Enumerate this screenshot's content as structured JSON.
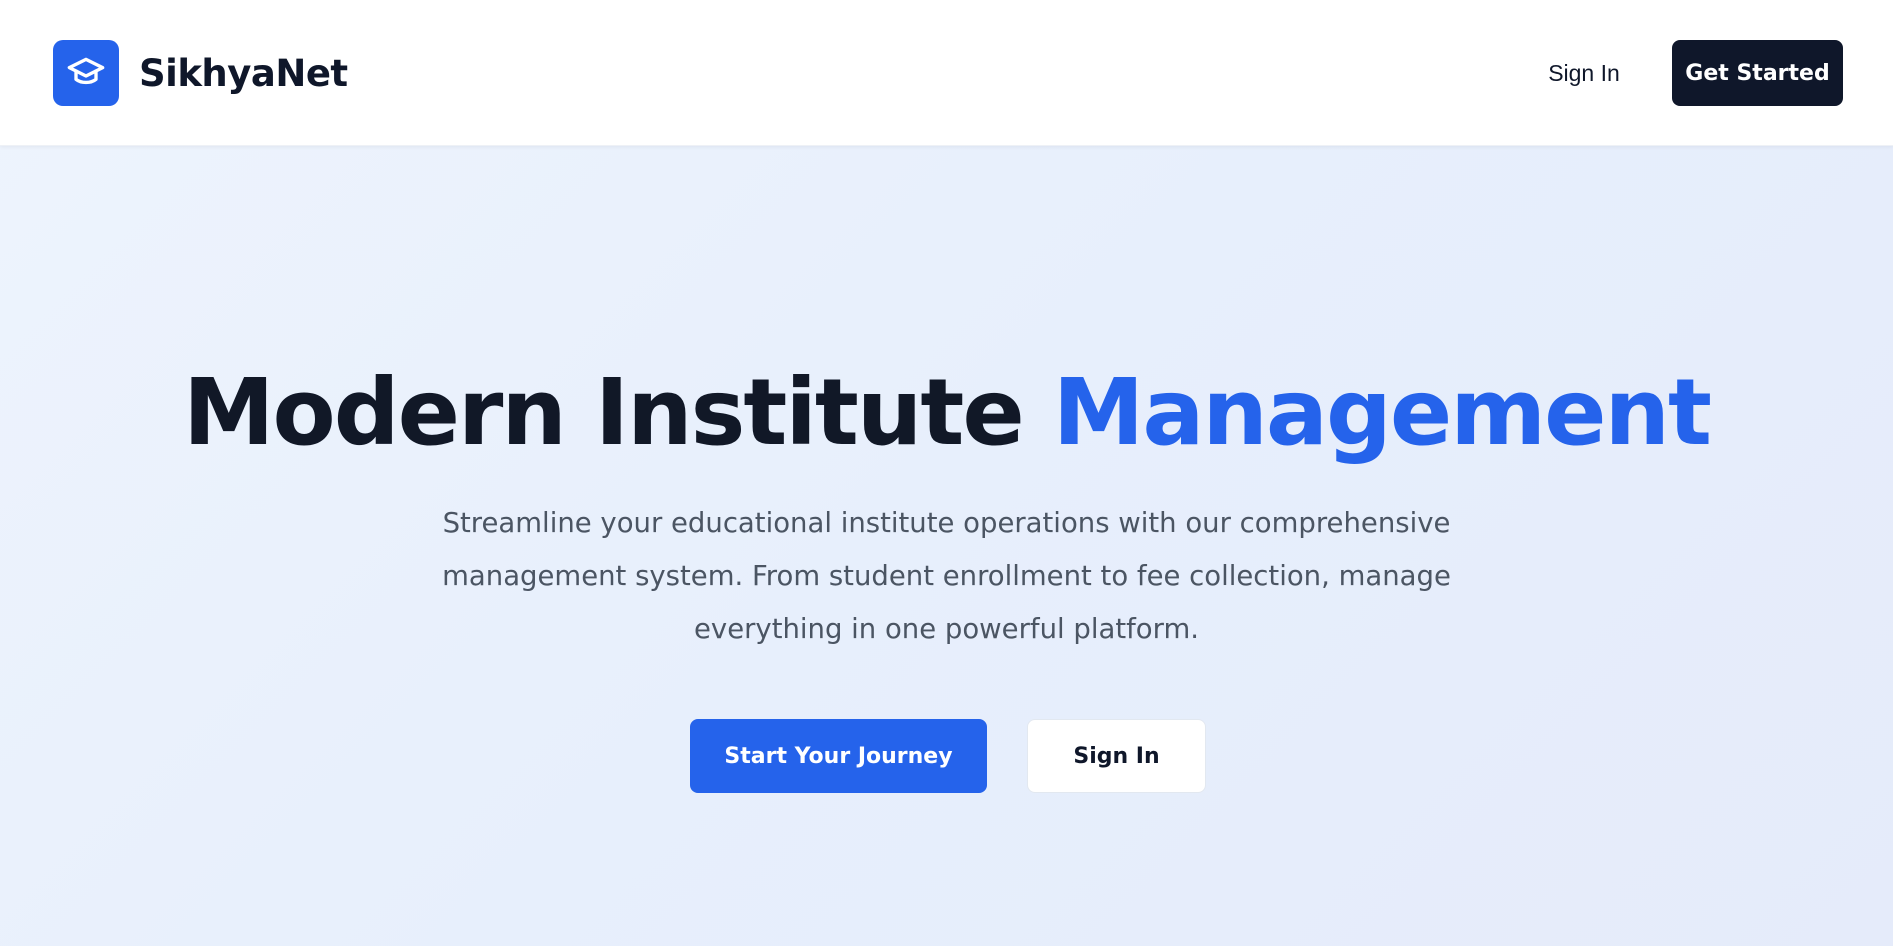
{
  "header": {
    "brand": "SikhyaNet",
    "logo_icon": "graduation-cap-icon",
    "sign_in_label": "Sign In",
    "get_started_label": "Get Started"
  },
  "hero": {
    "title_main": "Modern Institute",
    "title_accent": "Management",
    "subtitle": "Streamline your educational institute operations with our comprehensive management system. From student enrollment to fee collection, manage everything in one powerful platform.",
    "primary_cta": "Start Your Journey",
    "secondary_cta": "Sign In"
  },
  "colors": {
    "accent": "#2563eb",
    "dark": "#0f172a",
    "muted_text": "#4b5563"
  }
}
